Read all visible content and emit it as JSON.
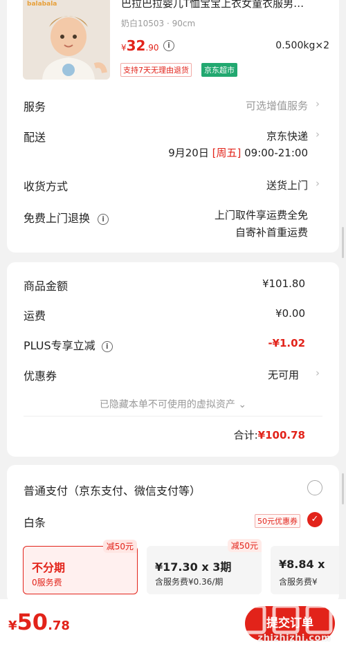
{
  "product": {
    "brand": "balabala",
    "title": "巴拉巴拉婴儿T恤宝宝上衣女童衣服男…",
    "spec": "奶白10503 · 90cm",
    "price_symbol": "¥",
    "price_int": "32",
    "price_dec": ".90",
    "weight": "0.500kg×2",
    "tag_return": "支持7天无理由退货",
    "tag_store": "京东超市"
  },
  "delivery": {
    "service_label": "服务",
    "service_value": "可选增值服务",
    "shipping_label": "配送",
    "shipping_value": "京东快递",
    "date_prefix": "9月20日",
    "date_weekday": "[周五]",
    "date_time": "09:00-21:00",
    "receive_label": "收货方式",
    "receive_value": "送货上门",
    "return_label": "免费上门退换",
    "return_line1": "上门取件享运费全免",
    "return_line2": "自寄补首重运费"
  },
  "summary": {
    "goods_label": "商品金额",
    "goods_value": "¥101.80",
    "freight_label": "运费",
    "freight_value": "¥0.00",
    "plus_label": "PLUS专享立减",
    "plus_value": "-¥1.02",
    "coupon_label": "优惠券",
    "coupon_value": "无可用",
    "hidden_note": "已隐藏本单不可使用的虚拟资产 ⌄",
    "total_label": "合计:",
    "total_value": "¥100.78"
  },
  "payment": {
    "normal_label": "普通支付（京东支付、微信支付等）",
    "baitiao_label": "白条",
    "baitiao_coupon": "50元优惠券",
    "plans": [
      {
        "badge": "减50元",
        "main": "不分期",
        "sub": "0服务费",
        "selected": true
      },
      {
        "badge": "减50元",
        "main": "¥17.30 x 3期",
        "sub": "含服务费¥0.36/期",
        "selected": false
      },
      {
        "badge": "",
        "main": "¥8.84 x",
        "sub": "含服务费¥",
        "selected": false
      }
    ]
  },
  "bottom": {
    "price_symbol": "¥",
    "price_int": "50",
    "price_dec": ".78",
    "submit_label": "提交订单",
    "watermark": "zhizhizhi.com"
  },
  "colors": {
    "accent": "#e2231a",
    "store_tag": "#22a870"
  },
  "icons": {
    "info": "info-icon",
    "chevron": "chevron-right-icon",
    "radio": "radio-unchecked-icon",
    "check": "check-icon"
  }
}
